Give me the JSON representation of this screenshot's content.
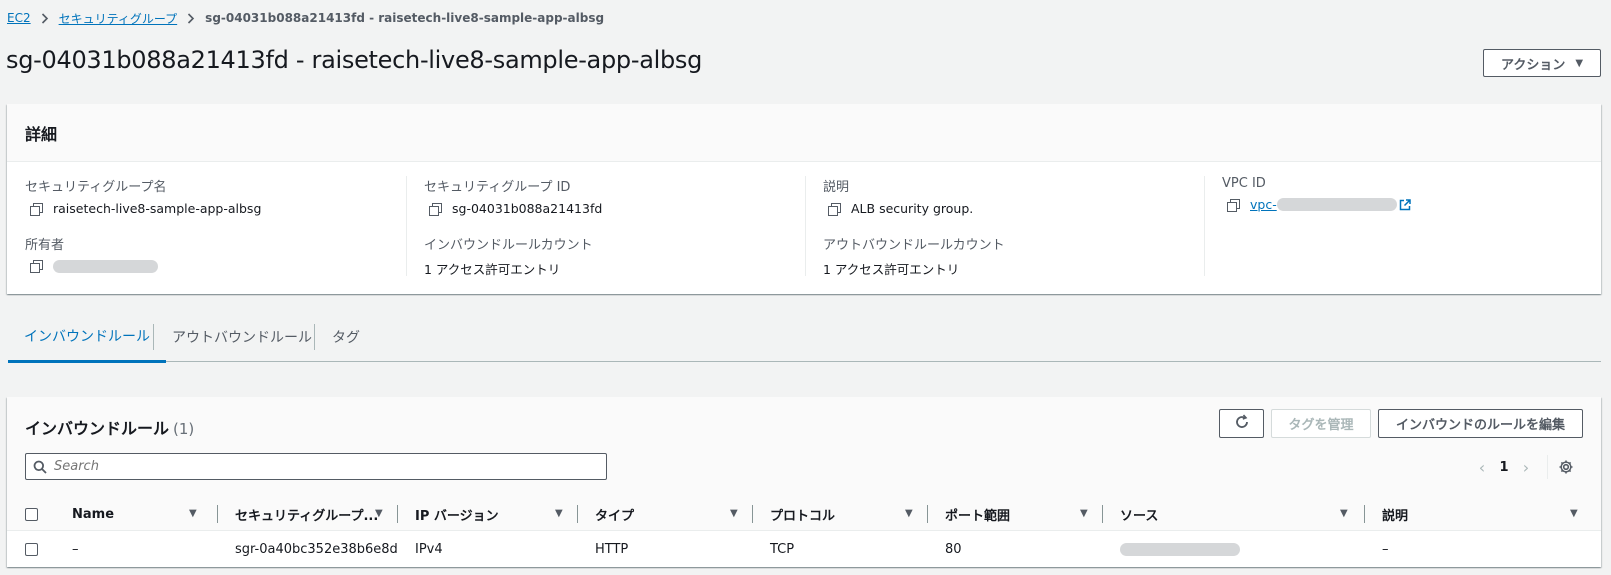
{
  "breadcrumb": {
    "items": [
      "EC2",
      "セキュリティグループ"
    ],
    "current": "sg-04031b088a21413fd - raisetech-live8-sample-app-albsg"
  },
  "header": {
    "title": "sg-04031b088a21413fd - raisetech-live8-sample-app-albsg",
    "action_label": "アクション"
  },
  "details": {
    "title": "詳細",
    "sg_name_label": "セキュリティグループ名",
    "sg_name": "raisetech-live8-sample-app-albsg",
    "sg_id_label": "セキュリティグループ ID",
    "sg_id": "sg-04031b088a21413fd",
    "desc_label": "説明",
    "desc": "ALB security group.",
    "vpc_label": "VPC ID",
    "vpc_prefix": "vpc-",
    "owner_label": "所有者",
    "inbound_count_label": "インバウンドルールカウント",
    "inbound_count": "1 アクセス許可エントリ",
    "outbound_count_label": "アウトバウンドルールカウント",
    "outbound_count": "1 アクセス許可エントリ"
  },
  "tabs": [
    "インバウンドルール",
    "アウトバウンドルール",
    "タグ"
  ],
  "rules": {
    "title": "インバウンドルール",
    "count": "(1)",
    "manage_tags_label": "タグを管理",
    "edit_label": "インバウンドのルールを編集",
    "search_placeholder": "Search",
    "page": "1",
    "columns": [
      "Name",
      "セキュリティグループ...",
      "IP バージョン",
      "タイプ",
      "プロトコル",
      "ポート範囲",
      "ソース",
      "説明"
    ],
    "rows": [
      {
        "name": "–",
        "rule_id": "sgr-0a40bc352e38b6e8d",
        "ip_version": "IPv4",
        "type": "HTTP",
        "protocol": "TCP",
        "port": "80",
        "description": "–"
      }
    ]
  },
  "colors": {
    "accent": "#0073bb",
    "text": "#16191f",
    "muted": "#545b64"
  }
}
